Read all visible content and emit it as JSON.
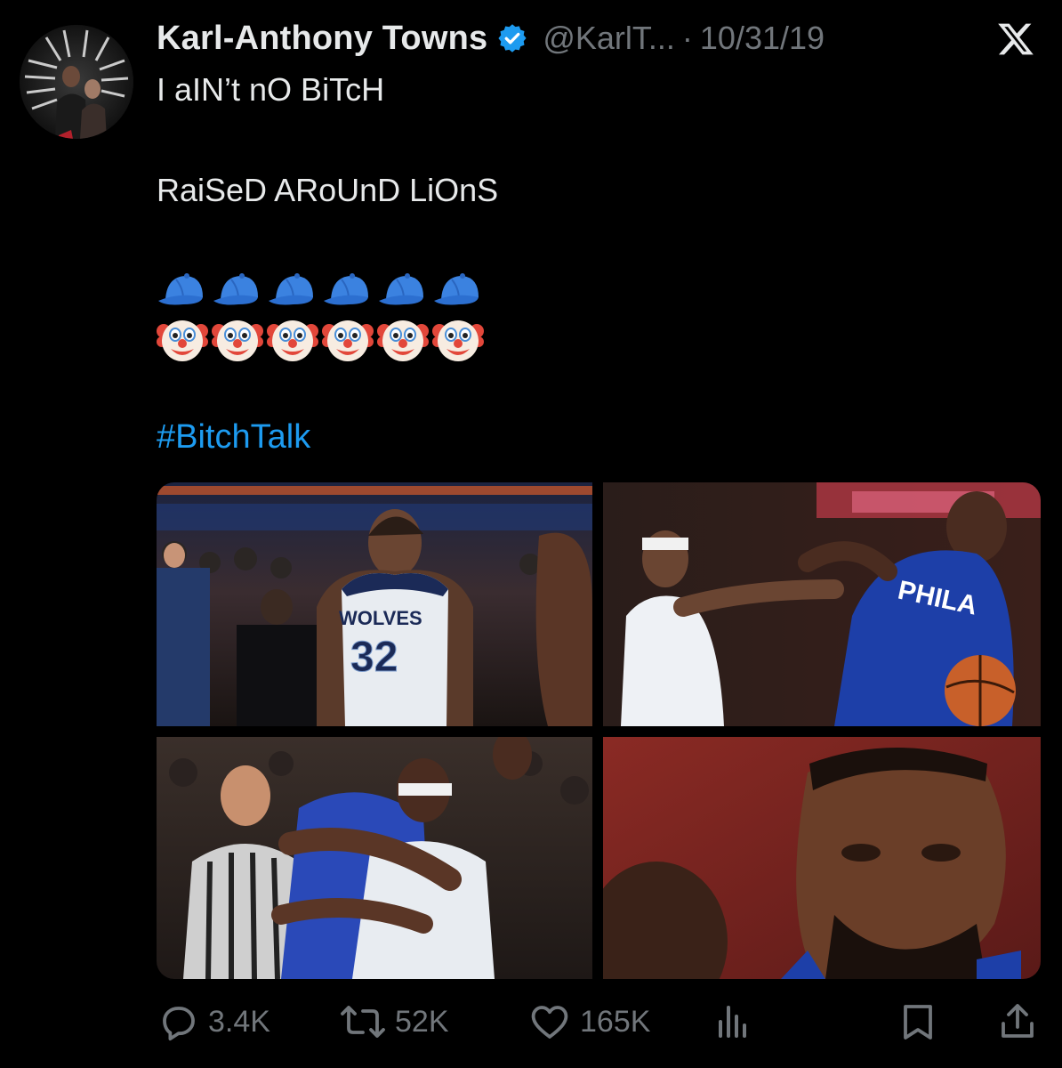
{
  "tweet": {
    "author_name": "Karl-Anthony Towns",
    "handle": "@KarlT...",
    "separator": "·",
    "date": "10/31/19",
    "verified_color": "#1d9bf0",
    "lines": [
      "I aIN’t nO BiTcH",
      "RaiSeD ARoUnD LiOnS"
    ],
    "emoji_rows": [
      {
        "icon": "blue-cap-emoji",
        "count": 6
      },
      {
        "icon": "clown-face-emoji",
        "count": 6
      }
    ],
    "hashtag": "#BitchTalk",
    "hashtag_color": "#1d9bf0",
    "photo_jersey_text": "WOLVES",
    "photo_jersey_number": "32",
    "photo_jersey_text_2": "PHILA"
  },
  "actions": {
    "replies": "3.4K",
    "reposts": "52K",
    "likes": "165K"
  },
  "icons": {
    "close": "x-logo-icon",
    "reply": "reply-icon",
    "repost": "repost-icon",
    "like": "heart-icon",
    "views": "views-icon",
    "bookmark": "bookmark-icon",
    "share": "share-icon"
  },
  "colors": {
    "background": "#000000",
    "text": "#e7e9ea",
    "muted": "#71767b",
    "accent": "#1d9bf0"
  }
}
